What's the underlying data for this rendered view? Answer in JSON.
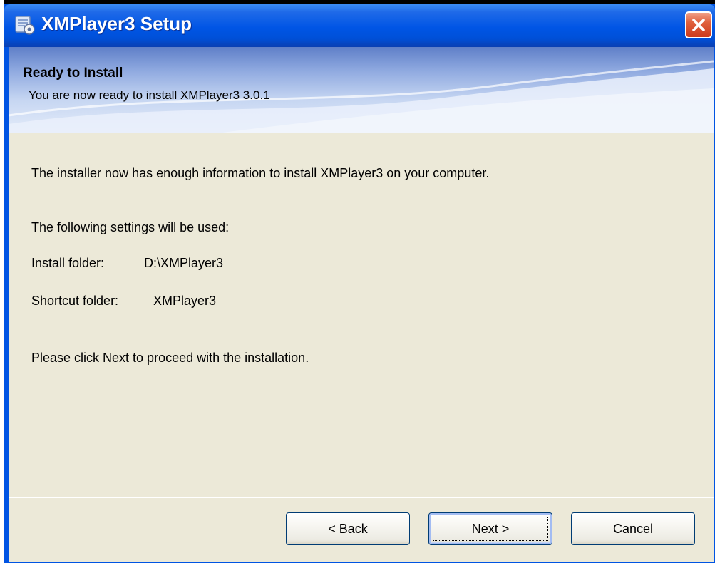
{
  "window": {
    "title": "XMPlayer3 Setup",
    "icon": "installer-app-icon",
    "close_icon": "close-icon",
    "titlebar_color": "#0055e5",
    "close_color": "#e0603c"
  },
  "header": {
    "title": "Ready to Install",
    "subtitle": "You are now ready to install XMPlayer3 3.0.1"
  },
  "body": {
    "intro": "The installer now has enough information to install XMPlayer3 on your computer.",
    "settings_heading": "The following settings will be used:",
    "settings": [
      {
        "label": "Install folder:",
        "value": "D:\\XMPlayer3"
      },
      {
        "label": "Shortcut folder:",
        "value": "XMPlayer3"
      }
    ],
    "instruction": "Please click Next to proceed with the installation."
  },
  "buttons": {
    "back": {
      "prefix": "< ",
      "mnemonic": "B",
      "rest": "ack"
    },
    "next": {
      "mnemonic": "N",
      "rest": "ext >"
    },
    "cancel": {
      "mnemonic": "C",
      "rest": "ancel"
    }
  },
  "colors": {
    "dialog_bg": "#ece9d8",
    "banner_top": "#5f7fc8",
    "banner_bottom": "#e4ecf9"
  }
}
